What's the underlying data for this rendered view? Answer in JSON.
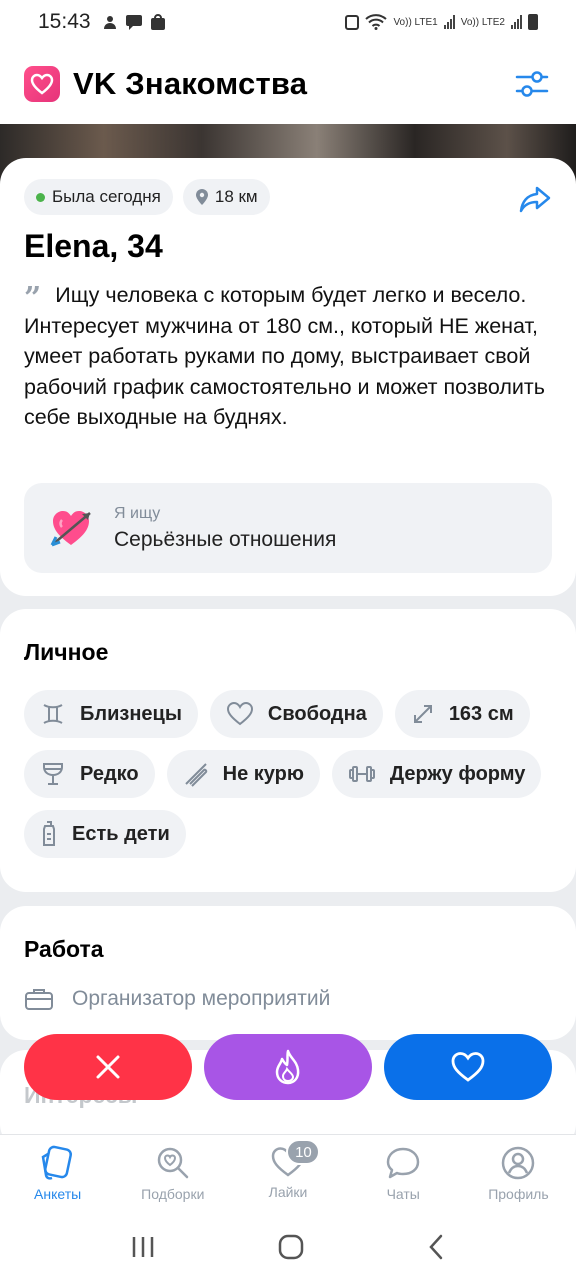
{
  "status_bar": {
    "time": "15:43",
    "sim1": "Vo)) LTE1",
    "sim2": "Vo)) LTE2"
  },
  "header": {
    "title": "VK Знакомства",
    "icons": {
      "logo": "heart-logo-icon",
      "filter": "sliders-icon"
    }
  },
  "profile": {
    "status": "Была сегодня",
    "distance": "18 км",
    "name": "Elena, 34",
    "bio": "Ищу человека с которым будет легко и весело. Интересует мужчина от 180 см., который НЕ женат, умеет работать руками по дому, выстраивает свой рабочий график самостоятельно и может позволить себе выходные на буднях.",
    "seeking_label": "Я ищу",
    "seeking_value": "Серьёзные отношения",
    "status_color": "#4bb34b"
  },
  "personal": {
    "title": "Личное",
    "tags": [
      {
        "label": "Близнецы",
        "icon": "gemini-icon"
      },
      {
        "label": "Свободна",
        "icon": "heart-outline-icon"
      },
      {
        "label": "163 см",
        "icon": "resize-arrows-icon"
      },
      {
        "label": "Редко",
        "icon": "wine-glass-icon"
      },
      {
        "label": "Не курю",
        "icon": "no-smoking-icon"
      },
      {
        "label": "Держу форму",
        "icon": "dumbbell-icon"
      },
      {
        "label": "Есть дети",
        "icon": "baby-bottle-icon"
      }
    ]
  },
  "work": {
    "title": "Работа",
    "occupation": "Организатор мероприятий"
  },
  "interests": {
    "title": "Интересы"
  },
  "actions": {
    "colors": {
      "dislike": "#ff3347",
      "super": "#a855e6",
      "like": "#0a70e9"
    }
  },
  "bottom_nav": {
    "items": [
      {
        "label": "Анкеты",
        "active": true
      },
      {
        "label": "Подборки"
      },
      {
        "label": "Лайки",
        "badge": "10"
      },
      {
        "label": "Чаты"
      },
      {
        "label": "Профиль"
      }
    ],
    "active_color": "#2688eb"
  }
}
